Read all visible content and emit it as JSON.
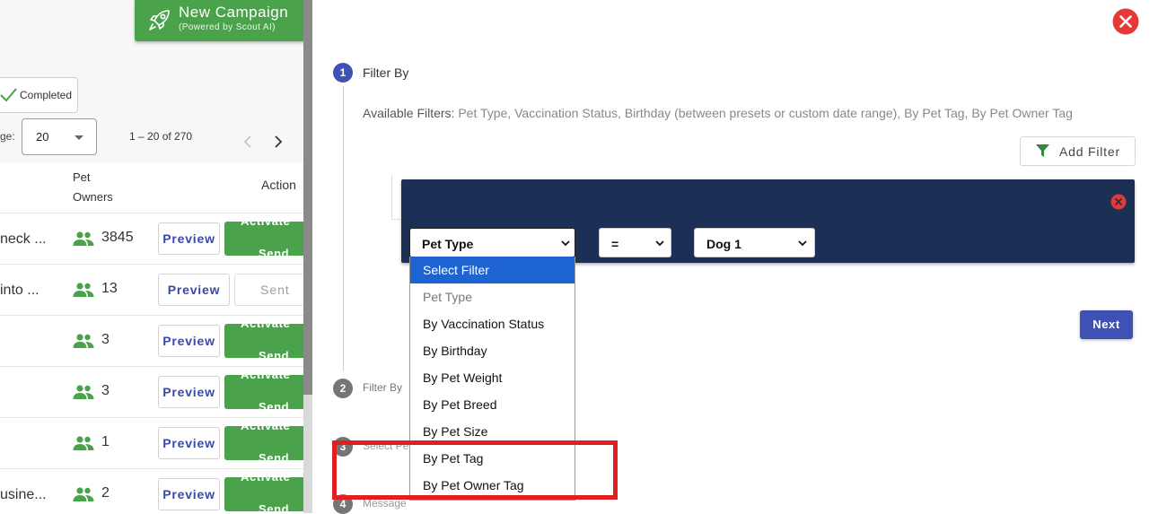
{
  "left": {
    "campaign_button": {
      "title": "New Campaign",
      "subtitle": "(Powered by Scout AI)"
    },
    "status_chip": "Completed",
    "pagination": {
      "per_page_label": "ge:",
      "per_page_value": "20",
      "range": "1 – 20 of 270"
    },
    "table": {
      "header_owners": "Pet Owners",
      "header_action": "Action",
      "preview_label": "Preview",
      "activate_label": "Activate",
      "send_label": "Send",
      "sent_label": "Sent",
      "rows": [
        {
          "name": "neck ...",
          "count": "3845",
          "state": "activate"
        },
        {
          "name": "into ...",
          "count": "13",
          "state": "sent"
        },
        {
          "name": "",
          "count": "3",
          "state": "activate"
        },
        {
          "name": "",
          "count": "3",
          "state": "activate"
        },
        {
          "name": "",
          "count": "1",
          "state": "activate"
        },
        {
          "name": "usine...",
          "count": "2",
          "state": "activate"
        }
      ]
    }
  },
  "panel": {
    "steps": [
      {
        "number": "1",
        "title": "Filter By"
      },
      {
        "number": "2",
        "title": "Filter By"
      },
      {
        "number": "3",
        "title": "Select Pe"
      },
      {
        "number": "4",
        "title": "Message"
      }
    ],
    "available_label": "Available Filters:",
    "available_list": "Pet Type, Vaccination Status, Birthday (between presets or custom date range), By Pet Tag, By Pet Owner Tag",
    "add_filter_label": "Add Filter",
    "filter": {
      "type_value": "Pet Type",
      "operator_value": "=",
      "value_value": "Dog 1"
    },
    "dropdown_options": [
      "Select Filter",
      "Pet Type",
      "By Vaccination Status",
      "By Birthday",
      "By Pet Weight",
      "By Pet Breed",
      "By Pet Size",
      "By Pet Tag",
      "By Pet Owner Tag"
    ],
    "next_label": "Next"
  },
  "colors": {
    "primary": "#3f51b5",
    "success": "#4aa24a",
    "filter_bg": "#1c2f55",
    "danger": "#e53935",
    "highlight": "#e02020",
    "option_selected": "#1e63d2"
  }
}
